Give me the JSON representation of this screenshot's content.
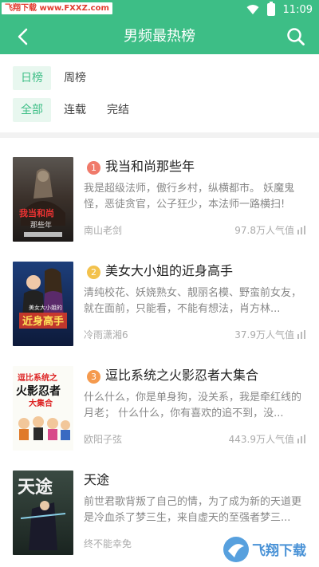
{
  "status": {
    "watermark": "飞翔下载 www.FXXZ.com",
    "time": "11:09"
  },
  "nav": {
    "title": "男频最热榜"
  },
  "filters": {
    "period": [
      "日榜",
      "周榜"
    ],
    "state": [
      "全部",
      "连载",
      "完结"
    ]
  },
  "books": [
    {
      "rank": "1",
      "title": "我当和尚那些年",
      "desc": "我是超级法师，傲行乡村，纵横都市。 妖魔鬼怪，恶徒贪官，公子狂少，本法师一路横扫!",
      "author": "南山老剑",
      "popularity": "97.8万人气值",
      "cover_title": "我当和尚那些年",
      "badge_color": "#f07a6a"
    },
    {
      "rank": "2",
      "title": "美女大小姐的近身高手",
      "desc": "清纯校花、妖娆熟女、靓丽名模、野蛮前女友，就在面前，只能看，不能有想法，肖方林...",
      "author": "冷雨潇湘6",
      "popularity": "37.9万人气值",
      "cover_title": "美女大小姐的近身高手",
      "badge_color": "#f3c24d"
    },
    {
      "rank": "3",
      "title": "逗比系统之火影忍者大集合",
      "desc": "什么什么，你是单身狗，没关系，我是牵红线的月老； 什么什么，你有喜欢的追不到，没...",
      "author": "欧阳子弦",
      "popularity": "443.9万人气值",
      "cover_title": "逗比系统之火影忍者大集合",
      "badge_color": "#f59a4e"
    },
    {
      "rank": "",
      "title": "天途",
      "desc": "前世君歌背叛了自己的情，为了成为新的天道更是冷血杀了梦三生，来自虚天的至强者梦三...",
      "author": "终不能幸免",
      "popularity": "",
      "cover_title": "天途",
      "badge_color": ""
    }
  ],
  "watermark_br": "飞翔下载"
}
